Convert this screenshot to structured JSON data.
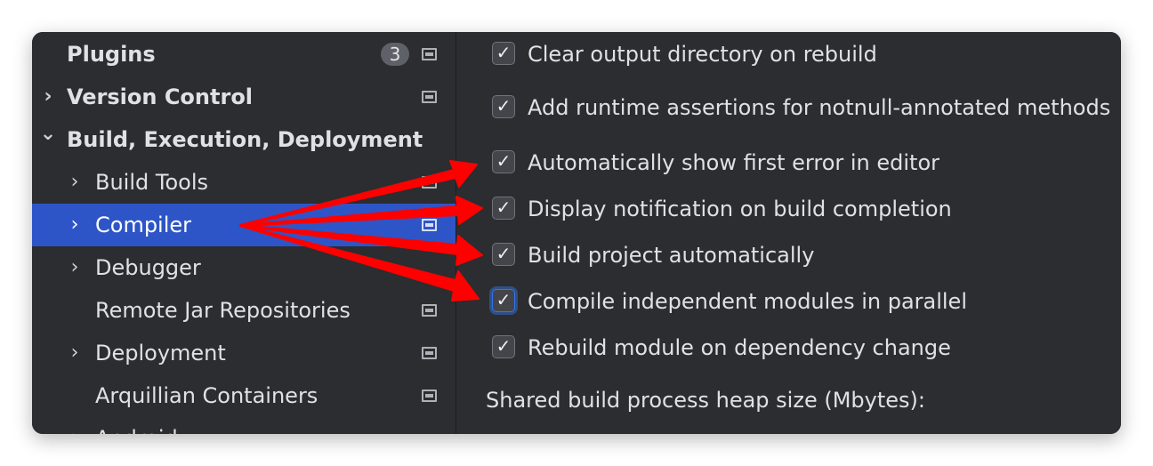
{
  "sidebar": {
    "items": [
      {
        "label": "Plugins",
        "badge": "3"
      },
      {
        "label": "Version Control"
      },
      {
        "label": "Build, Execution, Deployment"
      },
      {
        "label": "Build Tools"
      },
      {
        "label": "Compiler"
      },
      {
        "label": "Debugger"
      },
      {
        "label": "Remote Jar Repositories"
      },
      {
        "label": "Deployment"
      },
      {
        "label": "Arquillian Containers"
      },
      {
        "label": "Android"
      }
    ],
    "selected": "Compiler"
  },
  "compiler": {
    "options": [
      {
        "label": "Clear output directory on rebuild",
        "checked": true
      },
      {
        "label": "Add runtime assertions for notnull-annotated methods",
        "checked": true
      },
      {
        "label": "Automatically show first error in editor",
        "checked": true
      },
      {
        "label": "Display notification on build completion",
        "checked": true
      },
      {
        "label": "Build project automatically",
        "checked": true
      },
      {
        "label": "Compile independent modules in parallel",
        "checked": true
      },
      {
        "label": "Rebuild module on dependency change",
        "checked": true
      }
    ],
    "heap_label": "Shared build process heap size (Mbytes):"
  },
  "icons": {
    "check": "✓",
    "chevron_right": "›",
    "chevron_down": "⌄"
  },
  "colors": {
    "selection": "#2e55c7",
    "annotation_arrows": "#ff0000",
    "background": "#2b2d30"
  }
}
